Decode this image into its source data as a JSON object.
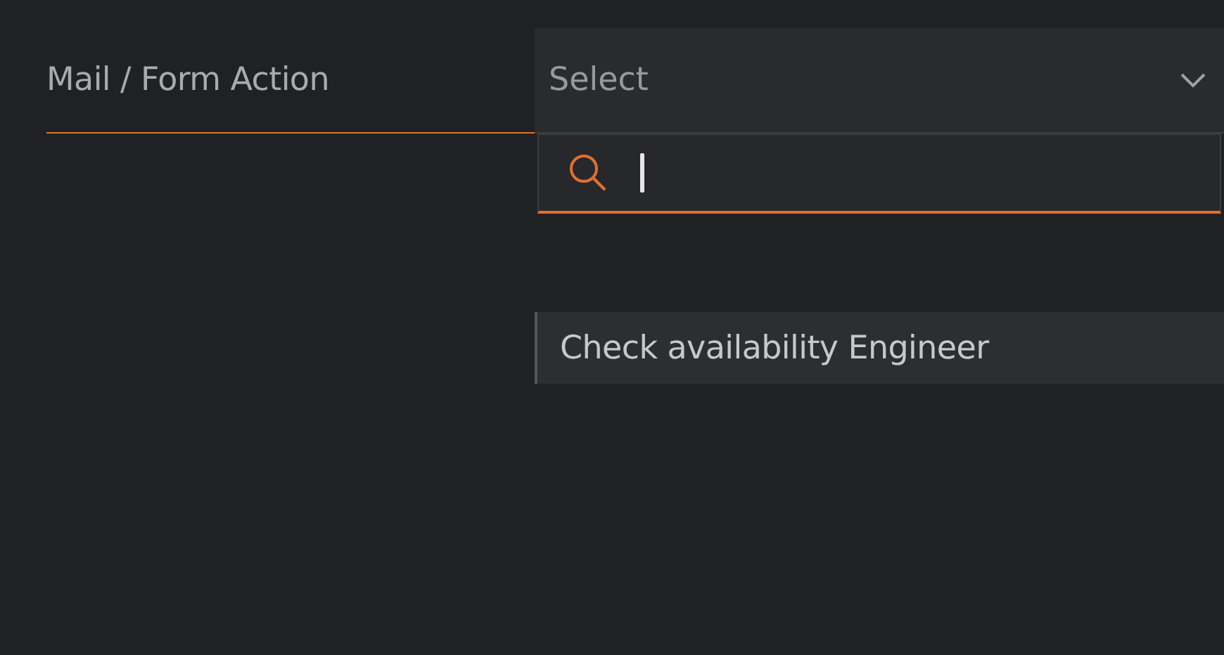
{
  "field": {
    "label": "Mail / Form Action"
  },
  "select": {
    "placeholder": "Select",
    "open": true
  },
  "search": {
    "focused": true
  },
  "options": [
    {
      "label": "Check availability Engineer",
      "highlighted": true
    }
  ]
}
